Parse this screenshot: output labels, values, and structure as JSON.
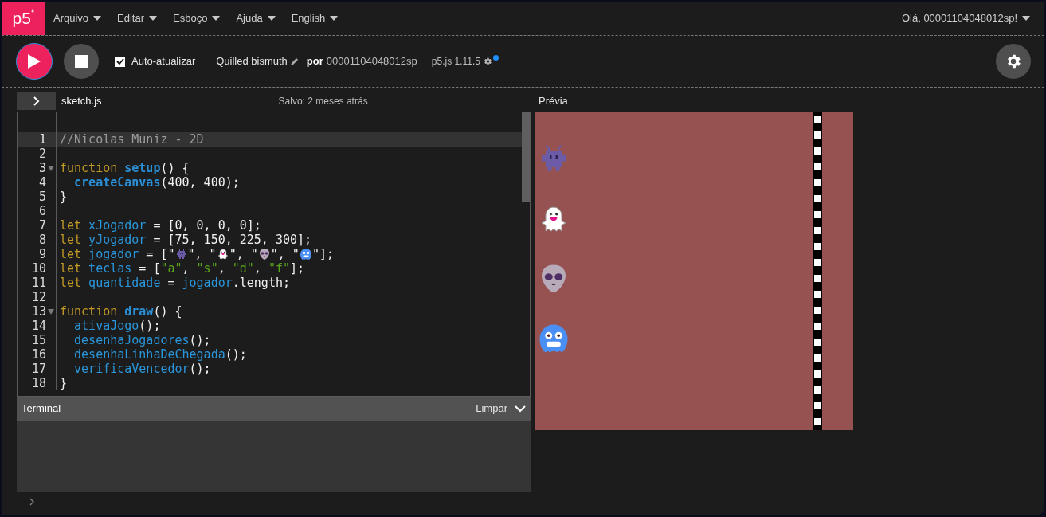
{
  "menu": {
    "logo": "p5",
    "logo_mark": "*",
    "items": [
      {
        "label": "Arquivo"
      },
      {
        "label": "Editar"
      },
      {
        "label": "Esboço"
      },
      {
        "label": "Ajuda"
      },
      {
        "label": "English"
      }
    ],
    "user": "Olá, 00001104048012sp!"
  },
  "toolbar": {
    "auto_refresh": {
      "label": "Auto-atualizar",
      "checked": true
    },
    "sketch_name": "Quilled bismuth",
    "by_label": "por",
    "author": "00001104048012sp",
    "version": "p5.js 1.11.5",
    "version_notice": true
  },
  "editor": {
    "file_name": "sketch.js",
    "saved_status": "Salvo: 2 meses atrás",
    "lines": [
      {
        "number": "1",
        "active": true,
        "foldable": false,
        "tokens": [
          {
            "kind": "comment",
            "text": "//Nicolas Muniz - 2D"
          }
        ]
      },
      {
        "number": "2",
        "active": false,
        "foldable": false
      },
      {
        "number": "3",
        "active": false,
        "foldable": true,
        "tokens": [
          {
            "kind": "keyword",
            "text": "function"
          },
          {
            "kind": "def",
            "text": " setup"
          },
          {
            "kind": "plain",
            "text": "() {"
          }
        ]
      },
      {
        "number": "4",
        "active": false,
        "foldable": false,
        "tokens": [
          {
            "kind": "def",
            "text": "  createCanvas"
          },
          {
            "kind": "plain",
            "text": "(400, 400);"
          }
        ]
      },
      {
        "number": "5",
        "active": false,
        "foldable": false,
        "tokens": [
          {
            "kind": "plain",
            "text": "}"
          }
        ]
      },
      {
        "number": "6",
        "active": false,
        "foldable": false
      },
      {
        "number": "7",
        "active": false,
        "foldable": false,
        "tokens": [
          {
            "kind": "keyword",
            "text": "let"
          },
          {
            "kind": "variable",
            "text": " xJogador"
          },
          {
            "kind": "plain",
            "text": " = [0, 0, 0, 0];"
          }
        ]
      },
      {
        "number": "8",
        "active": false,
        "foldable": false,
        "tokens": [
          {
            "kind": "keyword",
            "text": "let"
          },
          {
            "kind": "variable",
            "text": " yJogador"
          },
          {
            "kind": "plain",
            "text": " = [75, 150, 225, 300];"
          }
        ]
      },
      {
        "number": "9",
        "active": false,
        "foldable": false,
        "tokens": [
          {
            "kind": "keyword",
            "text": "let"
          },
          {
            "kind": "variable",
            "text": " jogador"
          },
          {
            "kind": "plain",
            "text": " = [\""
          },
          {
            "kind": "emoji"
          },
          {
            "kind": "plain",
            "text": "\", \""
          },
          {
            "kind": "emoji"
          },
          {
            "kind": "plain",
            "text": "\", \""
          },
          {
            "kind": "emoji"
          },
          {
            "kind": "plain",
            "text": "\", \""
          },
          {
            "kind": "emoji"
          },
          {
            "kind": "plain",
            "text": "\"];"
          }
        ]
      },
      {
        "number": "10",
        "active": false,
        "foldable": false,
        "tokens": [
          {
            "kind": "keyword",
            "text": "let"
          },
          {
            "kind": "variable",
            "text": " teclas"
          },
          {
            "kind": "plain",
            "text": " = ["
          },
          {
            "kind": "string",
            "text": "\"a\""
          },
          {
            "kind": "plain",
            "text": ", "
          },
          {
            "kind": "string",
            "text": "\"s\""
          },
          {
            "kind": "plain",
            "text": ", "
          },
          {
            "kind": "string",
            "text": "\"d\""
          },
          {
            "kind": "plain",
            "text": ", "
          },
          {
            "kind": "string",
            "text": "\"f\""
          },
          {
            "kind": "plain",
            "text": "];"
          }
        ]
      },
      {
        "number": "11",
        "active": false,
        "foldable": false,
        "tokens": [
          {
            "kind": "keyword",
            "text": "let"
          },
          {
            "kind": "variable",
            "text": " quantidade"
          },
          {
            "kind": "plain",
            "text": " = "
          },
          {
            "kind": "variable",
            "text": "jogador"
          },
          {
            "kind": "plain",
            "text": ".length;"
          }
        ]
      },
      {
        "number": "12",
        "active": false,
        "foldable": false
      },
      {
        "number": "13",
        "active": false,
        "foldable": true,
        "tokens": [
          {
            "kind": "keyword",
            "text": "function"
          },
          {
            "kind": "def",
            "text": " draw"
          },
          {
            "kind": "plain",
            "text": "() {"
          }
        ]
      },
      {
        "number": "14",
        "active": false,
        "foldable": false,
        "tokens": [
          {
            "kind": "variable",
            "text": "  ativaJogo"
          },
          {
            "kind": "plain",
            "text": "();"
          }
        ]
      },
      {
        "number": "15",
        "active": false,
        "foldable": false,
        "tokens": [
          {
            "kind": "variable",
            "text": "  desenhaJogadores"
          },
          {
            "kind": "plain",
            "text": "();"
          }
        ]
      },
      {
        "number": "16",
        "active": false,
        "foldable": false,
        "tokens": [
          {
            "kind": "variable",
            "text": "  desenhaLinhaDeChegada"
          },
          {
            "kind": "plain",
            "text": "();"
          }
        ]
      },
      {
        "number": "17",
        "active": false,
        "foldable": false,
        "tokens": [
          {
            "kind": "variable",
            "text": "  verificaVencedor"
          },
          {
            "kind": "plain",
            "text": "();"
          }
        ]
      },
      {
        "number": "18",
        "active": false,
        "foldable": false,
        "tokens": [
          {
            "kind": "plain",
            "text": "}"
          }
        ]
      }
    ]
  },
  "preview": {
    "title": "Prévia"
  },
  "console": {
    "title": "Terminal",
    "clear_label": "Limpar"
  }
}
